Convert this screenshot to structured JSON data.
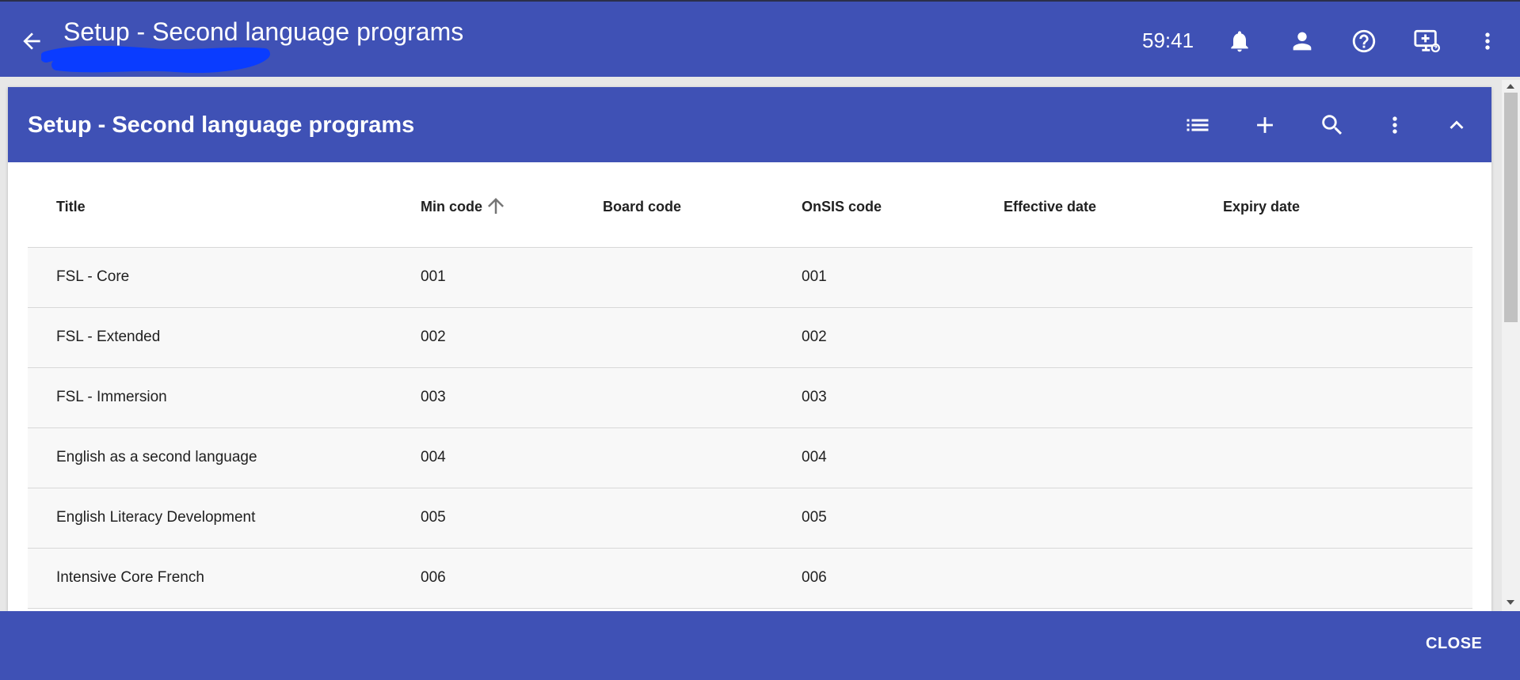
{
  "appbar": {
    "title": "Setup - Second language programs",
    "timer": "59:41",
    "icons": [
      "back-arrow-icon",
      "bell-icon",
      "person-icon",
      "help-circle-icon",
      "remote-support-icon",
      "more-vert-icon"
    ]
  },
  "dialog": {
    "title": "Setup - Second language programs",
    "icons": [
      "list-icon",
      "add-icon",
      "search-icon",
      "more-vert-icon",
      "chevron-up-icon"
    ]
  },
  "table": {
    "headers": {
      "title": "Title",
      "min_code": "Min code",
      "board_code": "Board code",
      "onsis_code": "OnSIS code",
      "effective_date": "Effective date",
      "expiry_date": "Expiry date"
    },
    "sort": {
      "column": "Min code",
      "direction": "ascending"
    },
    "rows": [
      {
        "title": "FSL - Core",
        "min_code": "001",
        "board_code": "",
        "onsis_code": "001",
        "effective_date": "",
        "expiry_date": ""
      },
      {
        "title": "FSL - Extended",
        "min_code": "002",
        "board_code": "",
        "onsis_code": "002",
        "effective_date": "",
        "expiry_date": ""
      },
      {
        "title": "FSL - Immersion",
        "min_code": "003",
        "board_code": "",
        "onsis_code": "003",
        "effective_date": "",
        "expiry_date": ""
      },
      {
        "title": "English as a second language",
        "min_code": "004",
        "board_code": "",
        "onsis_code": "004",
        "effective_date": "",
        "expiry_date": ""
      },
      {
        "title": "English Literacy Development",
        "min_code": "005",
        "board_code": "",
        "onsis_code": "005",
        "effective_date": "",
        "expiry_date": ""
      },
      {
        "title": "Intensive Core French",
        "min_code": "006",
        "board_code": "",
        "onsis_code": "006",
        "effective_date": "",
        "expiry_date": ""
      }
    ]
  },
  "footer": {
    "close_label": "CLOSE"
  },
  "colors": {
    "primary": "#3f51b5",
    "row_background": "#f8f8f8",
    "redaction": "#0a3cff"
  }
}
